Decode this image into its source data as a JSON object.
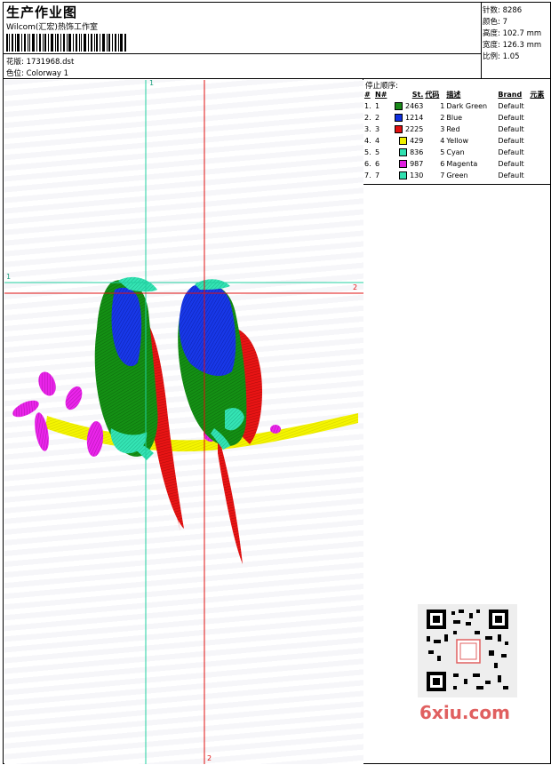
{
  "header": {
    "title": "生产作业图",
    "company": "Wilcom(汇宏)热饰工作室",
    "file_label": "花版:",
    "file_name": "1731968.dst",
    "colorway_label": "色位:",
    "colorway_name": "Colorway 1"
  },
  "stats": [
    {
      "label": "针数:",
      "value": "8286"
    },
    {
      "label": "颜色:",
      "value": "7"
    },
    {
      "label": "高度:",
      "value": "102.7 mm"
    },
    {
      "label": "宽度:",
      "value": "126.3 mm"
    },
    {
      "label": "比例:",
      "value": "1.05"
    }
  ],
  "sequence": {
    "heading": "停止顺序:",
    "columns": [
      "#",
      "N#",
      "St.",
      "代码",
      "描述",
      "Brand",
      "元素"
    ],
    "rows": [
      {
        "idx": "1.",
        "n": "1",
        "color": "#1a8a1a",
        "st": "2463",
        "code": "1",
        "desc": "Dark Green",
        "brand": "Default"
      },
      {
        "idx": "2.",
        "n": "2",
        "color": "#1030e0",
        "st": "1214",
        "code": "2",
        "desc": "Blue",
        "brand": "Default"
      },
      {
        "idx": "3.",
        "n": "3",
        "color": "#e01010",
        "st": "2225",
        "code": "3",
        "desc": "Red",
        "brand": "Default"
      },
      {
        "idx": "4.",
        "n": "4",
        "color": "#f0f000",
        "st": "429",
        "code": "4",
        "desc": "Yellow",
        "brand": "Default"
      },
      {
        "idx": "5.",
        "n": "5",
        "color": "#30e0b0",
        "st": "836",
        "code": "5",
        "desc": "Cyan",
        "brand": "Default"
      },
      {
        "idx": "6.",
        "n": "6",
        "color": "#e020e0",
        "st": "987",
        "code": "6",
        "desc": "Magenta",
        "brand": "Default"
      },
      {
        "idx": "7.",
        "n": "7",
        "color": "#30e0b0",
        "st": "130",
        "code": "7",
        "desc": "Green",
        "brand": "Default"
      }
    ]
  },
  "axes": {
    "a1": "1",
    "a2": "2"
  },
  "colors": {
    "green_line": "#20d0a0",
    "red_line": "#e01010"
  },
  "logo": {
    "text": "6xiu.com"
  }
}
